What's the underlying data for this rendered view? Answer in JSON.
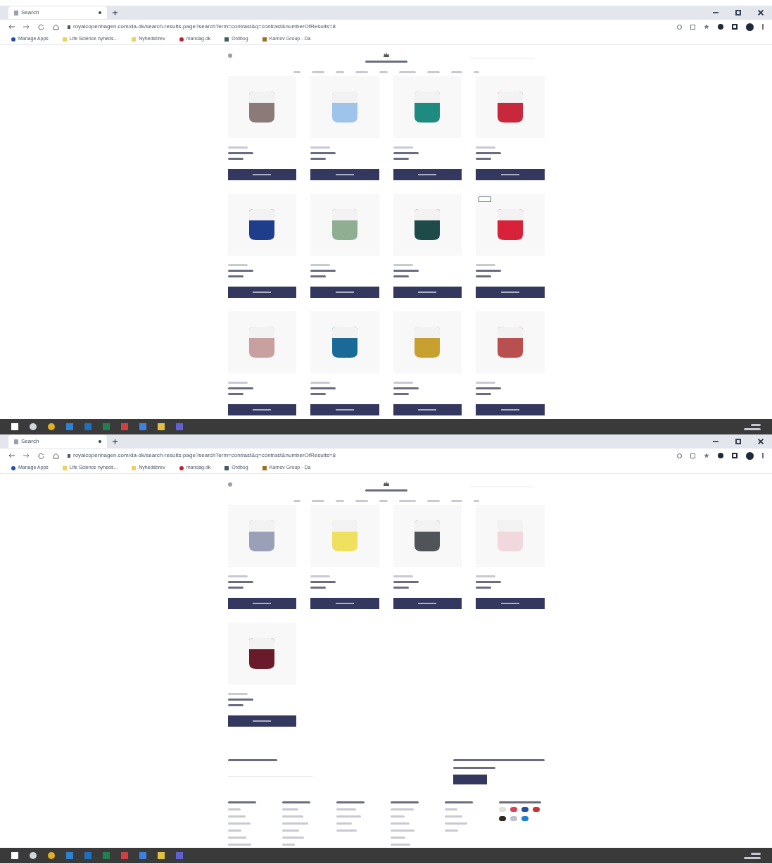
{
  "screens": [
    {
      "tab": {
        "title": "Search"
      },
      "url": "royalcopenhagen.com/da-dk/search-results-page?searchTerm=contrast&q=contrast&numberOfResults=8",
      "bookmarks": [
        "Manage Apps",
        "Life Science nyheds...",
        "Nyhedsbrev",
        "mandag.dk",
        "Ordbog",
        "Karnov Group - Da"
      ],
      "show_footer": false,
      "products": [
        {
          "color": "#8a7a78",
          "badge": false
        },
        {
          "color": "#9ec4ec",
          "badge": false
        },
        {
          "color": "#1f8a80",
          "badge": false
        },
        {
          "color": "#c8283c",
          "badge": false
        },
        {
          "color": "#1e3e8c",
          "badge": false
        },
        {
          "color": "#8fae92",
          "badge": false
        },
        {
          "color": "#1e4a4a",
          "badge": false
        },
        {
          "color": "#d8223a",
          "badge": true
        },
        {
          "color": "#c8a0a0",
          "badge": false
        },
        {
          "color": "#1a6a98",
          "badge": false
        },
        {
          "color": "#c8a030",
          "badge": false
        },
        {
          "color": "#b85050",
          "badge": false
        }
      ]
    },
    {
      "tab": {
        "title": "Search"
      },
      "url": "royalcopenhagen.com/da-dk/search-results-page?searchTerm=contrast&q=contrast&numberOfResults=8",
      "bookmarks": [
        "Manage Apps",
        "Life Science nyheds...",
        "Nyhedsbrev",
        "mandag.dk",
        "Ordbog",
        "Karnov Group - Da"
      ],
      "show_footer": true,
      "products": [
        {
          "color": "#9aa0b8",
          "badge": false
        },
        {
          "color": "#f0e060",
          "badge": false
        },
        {
          "color": "#505458",
          "badge": false
        },
        {
          "color": "#f0d8dc",
          "badge": false
        },
        {
          "color": "#6a1a2a",
          "badge": false
        }
      ]
    }
  ]
}
